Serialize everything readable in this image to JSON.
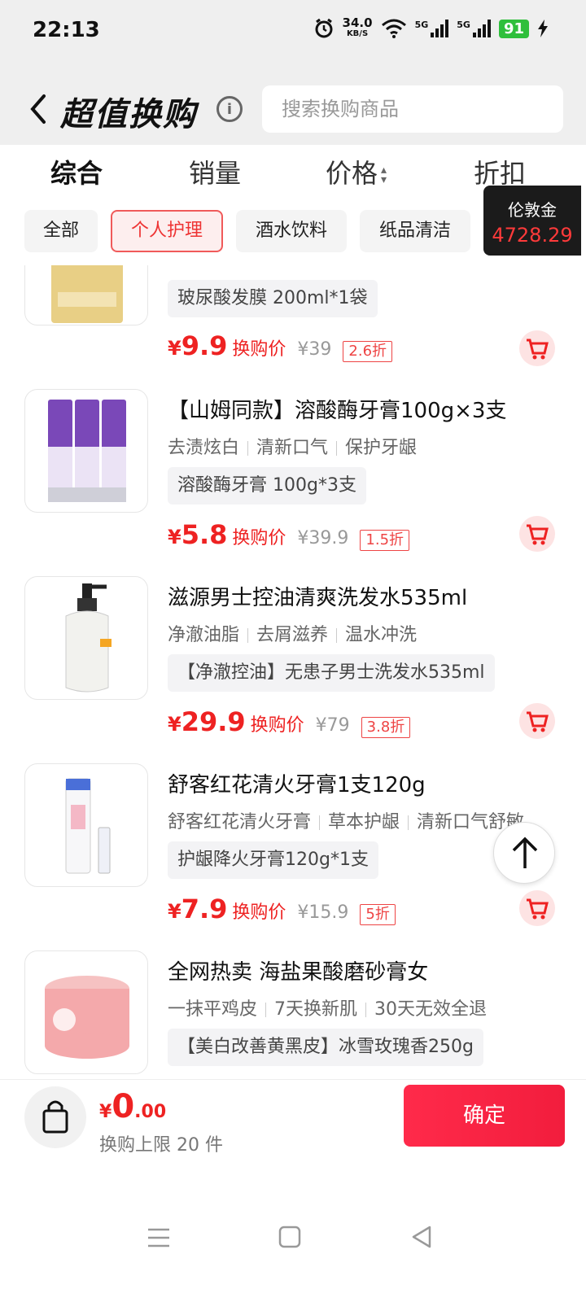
{
  "status": {
    "time": "22:13",
    "net_speed": "34.0",
    "net_unit": "KB/S",
    "battery": "91"
  },
  "header": {
    "title": "超值换购",
    "search_placeholder": "搜索换购商品"
  },
  "sort": {
    "items": [
      "综合",
      "销量",
      "价格",
      "折扣"
    ],
    "active": "综合"
  },
  "filters": {
    "chips": [
      "全部",
      "个人护理",
      "酒水饮料",
      "纸品清洁"
    ],
    "active": "个人护理"
  },
  "balance": {
    "label": "伦敦金",
    "amount": "4728.29"
  },
  "products": [
    {
      "name": "",
      "tags": [],
      "spec": "玻尿酸发膜 200ml*1袋",
      "price": "9.9",
      "price_label": "换购价",
      "orig": "¥39",
      "discount": "2.6折"
    },
    {
      "name": "【山姆同款】溶酸酶牙膏100g×3支",
      "tags": [
        "去渍炫白",
        "清新口气",
        "保护牙龈"
      ],
      "spec": "溶酸酶牙膏 100g*3支",
      "price": "5.8",
      "price_label": "换购价",
      "orig": "¥39.9",
      "discount": "1.5折"
    },
    {
      "name": "滋源男士控油清爽洗发水535ml",
      "tags": [
        "净澈油脂",
        "去屑滋养",
        "温水冲洗"
      ],
      "spec": "【净澈控油】无患子男士洗发水535ml",
      "price": "29.9",
      "price_label": "换购价",
      "orig": "¥79",
      "discount": "3.8折"
    },
    {
      "name": "舒客红花清火牙膏1支120g",
      "tags": [
        "舒客红花清火牙膏",
        "草本护龈",
        "清新口气舒敏"
      ],
      "spec": "护龈降火牙膏120g*1支",
      "price": "7.9",
      "price_label": "换购价",
      "orig": "¥15.9",
      "discount": "5折"
    },
    {
      "name": "全网热卖 海盐果酸磨砂膏女",
      "tags": [
        "一抹平鸡皮",
        "7天换新肌",
        "30天无效全退"
      ],
      "spec": "【美白改善黄黑皮】冰雪玫瑰香250g",
      "price": "",
      "price_label": "",
      "orig": "",
      "discount": ""
    }
  ],
  "bottom": {
    "currency": "¥",
    "total_int": "0",
    "total_dec": ".00",
    "limit": "换购上限 20 件",
    "confirm": "确定"
  },
  "colors": {
    "accent": "#ee2222",
    "balance_bg": "#1b1b1b",
    "battery": "#2fbf3c"
  }
}
